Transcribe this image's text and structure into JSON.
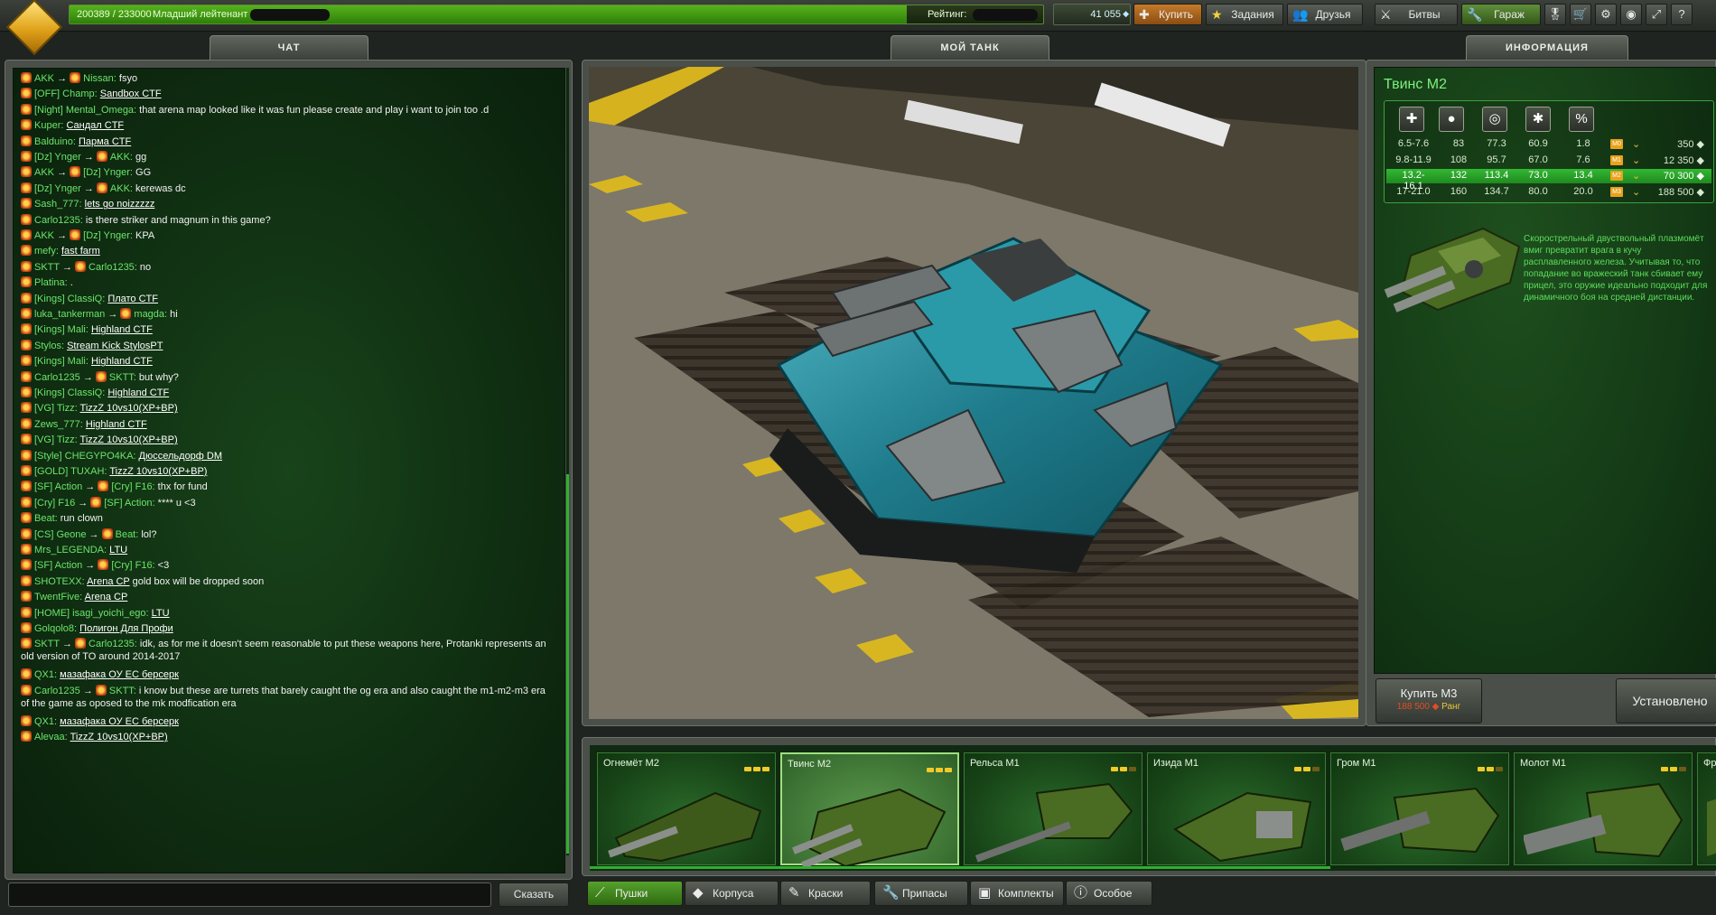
{
  "topbar": {
    "xp_text": "200389 / 233000",
    "rank_title": "Младший лейтенант",
    "xp_progress": 0.86,
    "rating_label": "Рейтинг:",
    "crystals": "41 055",
    "buy_label": "Купить",
    "quests_label": "Задания",
    "friends_label": "Друзья",
    "battles_label": "Битвы",
    "garage_label": "Гараж"
  },
  "tabs": {
    "chat": "ЧАТ",
    "my_tank": "МОЙ ТАНК",
    "info": "ИНФОРМАЦИЯ"
  },
  "chat": {
    "send_label": "Сказать",
    "messages": [
      {
        "parts": [
          {
            "t": "AKK",
            "c": "nm"
          },
          {
            "t": " → ",
            "c": "arrow"
          },
          {
            "t": "Nissan:",
            "c": "nm"
          },
          {
            "t": " fsyo",
            "c": "tx"
          }
        ]
      },
      {
        "parts": [
          {
            "t": "[OFF] Champ:",
            "c": "nm"
          },
          {
            "t": " ",
            "c": "tx"
          },
          {
            "t": "Sandbox CTF",
            "c": "lnk"
          }
        ]
      },
      {
        "parts": [
          {
            "t": "[Night] Mental_Omega:",
            "c": "nm"
          },
          {
            "t": " that arena map looked like it was fun please create and play i want to join too .d",
            "c": "tx"
          }
        ]
      },
      {
        "parts": [
          {
            "t": "Kuper:",
            "c": "nm"
          },
          {
            "t": " ",
            "c": "tx"
          },
          {
            "t": "Сандал CTF",
            "c": "lnk"
          }
        ]
      },
      {
        "parts": [
          {
            "t": "Balduino:",
            "c": "nm"
          },
          {
            "t": " ",
            "c": "tx"
          },
          {
            "t": "Парма CTF",
            "c": "lnk"
          }
        ]
      },
      {
        "parts": [
          {
            "t": "[Dz] Ynger",
            "c": "nm"
          },
          {
            "t": " → ",
            "c": "arrow"
          },
          {
            "t": "AKK:",
            "c": "nm"
          },
          {
            "t": " gg",
            "c": "tx"
          }
        ]
      },
      {
        "parts": [
          {
            "t": "AKK",
            "c": "nm"
          },
          {
            "t": " → ",
            "c": "arrow"
          },
          {
            "t": "[Dz] Ynger:",
            "c": "nm"
          },
          {
            "t": " GG",
            "c": "tx"
          }
        ]
      },
      {
        "parts": [
          {
            "t": "[Dz] Ynger",
            "c": "nm"
          },
          {
            "t": " → ",
            "c": "arrow"
          },
          {
            "t": "AKK:",
            "c": "nm"
          },
          {
            "t": " kerewas dc",
            "c": "tx"
          }
        ]
      },
      {
        "parts": [
          {
            "t": "Sash_777:",
            "c": "nm"
          },
          {
            "t": " ",
            "c": "tx"
          },
          {
            "t": "lets go noizzzzz",
            "c": "lnk"
          }
        ]
      },
      {
        "parts": [
          {
            "t": "Carlo1235:",
            "c": "nm"
          },
          {
            "t": " is there striker and magnum in this game?",
            "c": "tx"
          }
        ]
      },
      {
        "parts": [
          {
            "t": "AKK",
            "c": "nm"
          },
          {
            "t": " → ",
            "c": "arrow"
          },
          {
            "t": "[Dz] Ynger:",
            "c": "nm"
          },
          {
            "t": " KPA",
            "c": "tx"
          }
        ]
      },
      {
        "parts": [
          {
            "t": "mefy:",
            "c": "nm"
          },
          {
            "t": " ",
            "c": "tx"
          },
          {
            "t": "fast farm",
            "c": "lnk"
          }
        ]
      },
      {
        "parts": [
          {
            "t": "SKTT",
            "c": "nm"
          },
          {
            "t": " → ",
            "c": "arrow"
          },
          {
            "t": "Carlo1235:",
            "c": "nm"
          },
          {
            "t": " no",
            "c": "tx"
          }
        ]
      },
      {
        "parts": [
          {
            "t": "Platina:",
            "c": "nm"
          },
          {
            "t": " .",
            "c": "tx"
          }
        ]
      },
      {
        "parts": [
          {
            "t": "[Kings] ClassiQ:",
            "c": "nm"
          },
          {
            "t": " ",
            "c": "tx"
          },
          {
            "t": "Плато CTF",
            "c": "lnk"
          }
        ]
      },
      {
        "parts": [
          {
            "t": "luka_tankerman",
            "c": "nm"
          },
          {
            "t": " → ",
            "c": "arrow"
          },
          {
            "t": "magda:",
            "c": "nm"
          },
          {
            "t": " hi",
            "c": "tx"
          }
        ]
      },
      {
        "parts": [
          {
            "t": "[Kings] Mali:",
            "c": "nm"
          },
          {
            "t": " ",
            "c": "tx"
          },
          {
            "t": "Highland CTF",
            "c": "lnk"
          }
        ]
      },
      {
        "parts": [
          {
            "t": "Stylos:",
            "c": "nm"
          },
          {
            "t": " ",
            "c": "tx"
          },
          {
            "t": "Stream Kick StylosPT",
            "c": "lnk"
          }
        ]
      },
      {
        "parts": [
          {
            "t": "[Kings] Mali:",
            "c": "nm"
          },
          {
            "t": " ",
            "c": "tx"
          },
          {
            "t": "Highland CTF",
            "c": "lnk"
          }
        ]
      },
      {
        "parts": [
          {
            "t": "Carlo1235",
            "c": "nm"
          },
          {
            "t": " → ",
            "c": "arrow"
          },
          {
            "t": "SKTT:",
            "c": "nm"
          },
          {
            "t": " but why?",
            "c": "tx"
          }
        ]
      },
      {
        "parts": [
          {
            "t": "[Kings] ClassiQ:",
            "c": "nm"
          },
          {
            "t": " ",
            "c": "tx"
          },
          {
            "t": "Highland CTF",
            "c": "lnk"
          }
        ]
      },
      {
        "parts": [
          {
            "t": "[VG] Tizz:",
            "c": "nm"
          },
          {
            "t": " ",
            "c": "tx"
          },
          {
            "t": "TizzZ 10vs10(XP+BP)",
            "c": "lnk"
          }
        ]
      },
      {
        "parts": [
          {
            "t": "Zews_777:",
            "c": "nm"
          },
          {
            "t": " ",
            "c": "tx"
          },
          {
            "t": "Highland CTF",
            "c": "lnk"
          }
        ]
      },
      {
        "parts": [
          {
            "t": "[VG] Tizz:",
            "c": "nm"
          },
          {
            "t": " ",
            "c": "tx"
          },
          {
            "t": "TizzZ 10vs10(XP+BP)",
            "c": "lnk"
          }
        ]
      },
      {
        "parts": [
          {
            "t": "[Style] CHEGYPO4KA:",
            "c": "nm"
          },
          {
            "t": " ",
            "c": "tx"
          },
          {
            "t": "Дюссельдорф DM",
            "c": "lnk"
          }
        ]
      },
      {
        "parts": [
          {
            "t": "[GOLD] TUXAH:",
            "c": "nm"
          },
          {
            "t": " ",
            "c": "tx"
          },
          {
            "t": "TizzZ 10vs10(XP+BP)",
            "c": "lnk"
          }
        ]
      },
      {
        "parts": [
          {
            "t": "[SF] Action",
            "c": "nm"
          },
          {
            "t": " → ",
            "c": "arrow"
          },
          {
            "t": "[Cry] F16:",
            "c": "nm"
          },
          {
            "t": " thx for fund",
            "c": "tx"
          }
        ]
      },
      {
        "parts": [
          {
            "t": "[Cry] F16",
            "c": "nm"
          },
          {
            "t": " → ",
            "c": "arrow"
          },
          {
            "t": "[SF] Action:",
            "c": "nm"
          },
          {
            "t": " **** u <3",
            "c": "tx"
          }
        ]
      },
      {
        "parts": [
          {
            "t": "Beat:",
            "c": "nm"
          },
          {
            "t": " run clown",
            "c": "tx"
          }
        ]
      },
      {
        "parts": [
          {
            "t": "[CS] Geone",
            "c": "nm"
          },
          {
            "t": " → ",
            "c": "arrow"
          },
          {
            "t": "Beat:",
            "c": "nm"
          },
          {
            "t": " lol?",
            "c": "tx"
          }
        ]
      },
      {
        "parts": [
          {
            "t": "Mrs_LEGENDA:",
            "c": "nm"
          },
          {
            "t": " ",
            "c": "tx"
          },
          {
            "t": "LTU",
            "c": "lnk"
          }
        ]
      },
      {
        "parts": [
          {
            "t": "[SF] Action",
            "c": "nm"
          },
          {
            "t": " → ",
            "c": "arrow"
          },
          {
            "t": "[Cry] F16:",
            "c": "nm"
          },
          {
            "t": " <3",
            "c": "tx"
          }
        ]
      },
      {
        "parts": [
          {
            "t": "SHOTEXX:",
            "c": "nm"
          },
          {
            "t": " ",
            "c": "tx"
          },
          {
            "t": "Arena CP",
            "c": "lnk"
          },
          {
            "t": " gold box will be dropped soon",
            "c": "tx"
          }
        ]
      },
      {
        "parts": [
          {
            "t": "TwentFive:",
            "c": "nm"
          },
          {
            "t": " ",
            "c": "tx"
          },
          {
            "t": "Arena CP",
            "c": "lnk"
          }
        ]
      },
      {
        "parts": [
          {
            "t": "[HOME] isagi_yoichi_ego:",
            "c": "nm"
          },
          {
            "t": " ",
            "c": "tx"
          },
          {
            "t": "LTU",
            "c": "lnk"
          }
        ]
      },
      {
        "parts": [
          {
            "t": "Golqolo8:",
            "c": "nm"
          },
          {
            "t": " ",
            "c": "tx"
          },
          {
            "t": "Полигон  Для Профи",
            "c": "lnk"
          }
        ]
      },
      {
        "parts": [
          {
            "t": "SKTT",
            "c": "nm"
          },
          {
            "t": " → ",
            "c": "arrow"
          },
          {
            "t": "Carlo1235:",
            "c": "nm"
          },
          {
            "t": " idk, as for me it doesn't seem reasonable to put these weapons here, Protanki represents an old version of TO around 2014-2017",
            "c": "tx"
          }
        ],
        "lines": 2
      },
      {
        "parts": [
          {
            "t": "QX1:",
            "c": "nm"
          },
          {
            "t": " ",
            "c": "tx"
          },
          {
            "t": "мазафака ОУ ЕС берсерк",
            "c": "lnk"
          }
        ]
      },
      {
        "parts": [
          {
            "t": "Carlo1235",
            "c": "nm"
          },
          {
            "t": " → ",
            "c": "arrow"
          },
          {
            "t": "SKTT:",
            "c": "nm"
          },
          {
            "t": " i know but these are turrets that barely caught the og era and also caught the m1-m2-m3 era of the game as oposed to the mk modfication era",
            "c": "tx"
          }
        ],
        "lines": 2
      },
      {
        "parts": [
          {
            "t": "QX1:",
            "c": "nm"
          },
          {
            "t": " ",
            "c": "tx"
          },
          {
            "t": "мазафака ОУ ЕС берсерк",
            "c": "lnk"
          }
        ]
      },
      {
        "parts": [
          {
            "t": "Alevaa:",
            "c": "nm"
          },
          {
            "t": " ",
            "c": "tx"
          },
          {
            "t": "TizzZ 10vs10(XP+BP)",
            "c": "lnk"
          }
        ]
      }
    ]
  },
  "info": {
    "item_name": "Твинс М2",
    "stat_icons": [
      "damage-icon",
      "fire-rate-icon",
      "range-icon",
      "projectile-speed-icon",
      "critical-icon"
    ],
    "stats_rows": [
      {
        "c": [
          "6.5-7.6",
          "83",
          "77.3",
          "60.9",
          "1.8"
        ],
        "mod": "M0",
        "price": "350",
        "active": false
      },
      {
        "c": [
          "9.8-11.9",
          "108",
          "95.7",
          "67.0",
          "7.6"
        ],
        "mod": "M1",
        "price": "12 350",
        "active": false
      },
      {
        "c": [
          "13.2-16.1",
          "132",
          "113.4",
          "73.0",
          "13.4"
        ],
        "mod": "M2",
        "price": "70 300",
        "active": true
      },
      {
        "c": [
          "17-21.0",
          "160",
          "134.7",
          "80.0",
          "20.0"
        ],
        "mod": "M3",
        "price": "188 500",
        "active": false
      }
    ],
    "description": "Скорострельный двуствольный плазмомёт вмиг превратит врага в кучу расплавленного железа. Учитывая то, что попадание во вражеский танк сбивает ему прицел, это оружие идеально подходит для динамичного боя на средней дистанции.",
    "buy_label": "Купить М3",
    "buy_price": "188 500",
    "buy_rank": "Ранг",
    "installed_label": "Установлено"
  },
  "strip": {
    "items": [
      {
        "label": "Огнемёт М2",
        "level": 2
      },
      {
        "label": "Твинс М2",
        "level": 2
      },
      {
        "label": "Рельса М1",
        "level": 1
      },
      {
        "label": "Изида М1",
        "level": 1
      },
      {
        "label": "Гром М1",
        "level": 1
      },
      {
        "label": "Молот М1",
        "level": 1
      },
      {
        "label": "Фр",
        "level": 0
      }
    ],
    "selected_index": 1
  },
  "categories": {
    "turrets": "Пушки",
    "hulls": "Корпуса",
    "paints": "Краски",
    "supplies": "Припасы",
    "kits": "Комплекты",
    "special": "Особое"
  },
  "colors": {
    "accent_green": "#2fb02f",
    "name_green": "#6be56b",
    "price_red": "#e34c22"
  }
}
